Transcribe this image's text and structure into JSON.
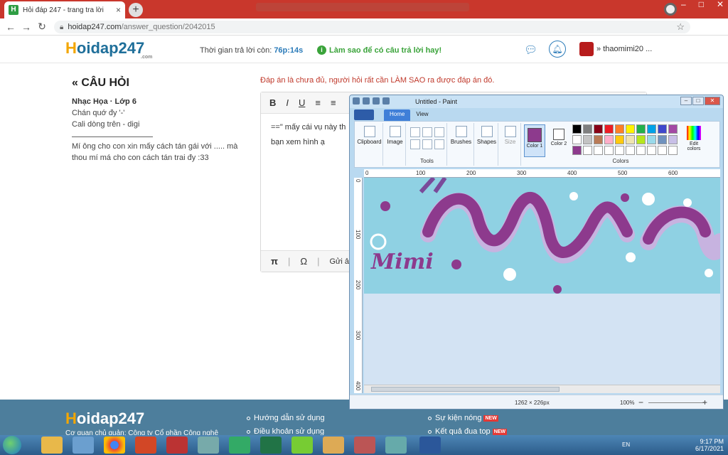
{
  "browser": {
    "tab_title": "Hỏi đáp 247 - trang tra lời",
    "url_host": "hoidap247.com",
    "url_path": "/answer_question/2042015",
    "new_tab": "+",
    "tab_close": "×"
  },
  "header": {
    "logo": "oidap247",
    "logo_h": "H",
    "logo_com": ".com",
    "timer_label": "Thời gian trả lời còn:",
    "timer_value": "76p:14s",
    "hint": "Làm sao để có câu trả lời hay!",
    "username": "thaomimi20 ..."
  },
  "question": {
    "heading": "« CÂU HỎI",
    "meta": "Nhạc Họa · Lớp 6",
    "lines": [
      "Chán quớ đy '-'",
      "Cali dòng trên - digi",
      "Mí ông cho con xin mấy cách tán gái với ..... mà",
      "thou mí má cho con cách tán trai đy :33"
    ]
  },
  "answer": {
    "notice": "Đáp án là chưa đủ, người hỏi rất cần LÀM SAO ra được đáp án đó.",
    "text1": "==\" mấy cái vụ này th",
    "text2": "bạn xem hình ạ",
    "toolbar": [
      "B",
      "I",
      "U",
      "≡",
      "≡"
    ],
    "footer": [
      "π",
      "|",
      "Ω",
      "|",
      "Gửi ảnh"
    ]
  },
  "paint": {
    "title": "Untitled - Paint",
    "tabs": [
      "Home",
      "View"
    ],
    "groups": {
      "clipboard": "Clipboard",
      "image": "Image",
      "tools": "Tools",
      "brushes": "Brushes",
      "shapes": "Shapes",
      "size": "Size",
      "color1": "Color 1",
      "color2": "Color 2",
      "colors": "Colors",
      "edit": "Edit colors"
    },
    "hruler": [
      "0",
      "100",
      "200",
      "300",
      "400",
      "500",
      "600"
    ],
    "vruler": [
      "0",
      "100",
      "200",
      "300",
      "400"
    ],
    "palette": [
      "#000000",
      "#7f7f7f",
      "#880015",
      "#ed1c24",
      "#ff7f27",
      "#fff200",
      "#22b14c",
      "#00a2e8",
      "#3f48cc",
      "#a349a4",
      "#ffffff",
      "#c3c3c3",
      "#b97a57",
      "#ffaec9",
      "#ffc90e",
      "#efe4b0",
      "#b5e61d",
      "#99d9ea",
      "#7092be",
      "#c8bfe7",
      "#8d3a8d",
      "#ffffff",
      "#ffffff",
      "#ffffff",
      "#ffffff",
      "#ffffff",
      "#ffffff",
      "#ffffff",
      "#ffffff",
      "#ffffff"
    ],
    "image_text": "Mimi",
    "dims": "1262 × 226px",
    "zoom": "100%",
    "zoom_minus": "−",
    "zoom_plus": "+"
  },
  "footer": {
    "logo": "oidap247",
    "logo_h": "H",
    "logo_com": ".com",
    "sub": "Cơ quan chủ quản: Công ty Cổ phần Công nghệ",
    "links": [
      "Hướng dẫn sử dụng",
      "Điều khoản sử dụng",
      "Sự kiện nóng",
      "Kết quả đua top"
    ],
    "new": "NEW"
  },
  "taskbar": {
    "lang": "EN",
    "time": "9:17 PM",
    "date": "6/17/2021"
  },
  "colors": {
    "tab_red": "#c9372c",
    "link_blue": "#2b7bb9",
    "footer": "#4d7e9c",
    "paint_accent": "#8d3a8d"
  }
}
